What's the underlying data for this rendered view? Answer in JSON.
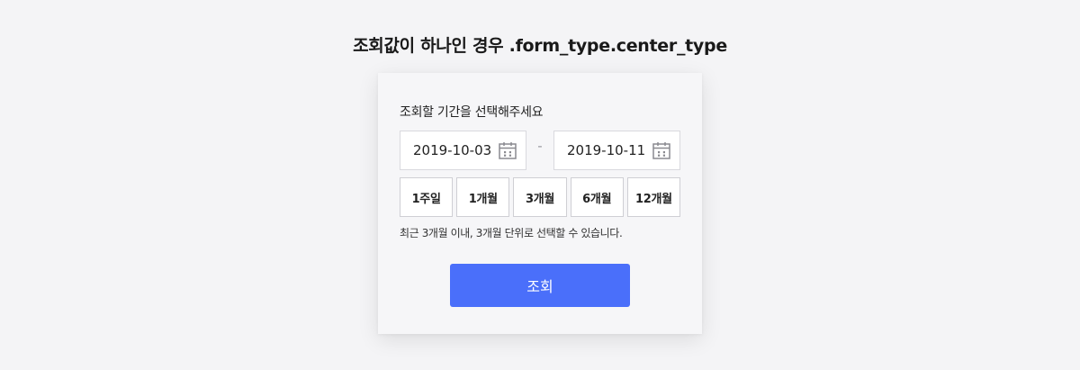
{
  "heading": "조회값이 하나인 경우 .form_type.center_type",
  "form": {
    "label": "조회할 기간을 선택해주세요",
    "start_date": "2019-10-03",
    "end_date": "2019-10-11",
    "separator": "-",
    "calendar_icon": "calendar-icon",
    "periods": [
      "1주일",
      "1개월",
      "3개월",
      "6개월",
      "12개월"
    ],
    "help_text": "최근 3개월 이내, 3개월 단위로 선택할 수 있습니다.",
    "submit_label": "조회"
  },
  "colors": {
    "background": "#f4f4f6",
    "card": "#f6f6f8",
    "primary": "#4a6ffa",
    "border": "#d9d9de"
  }
}
